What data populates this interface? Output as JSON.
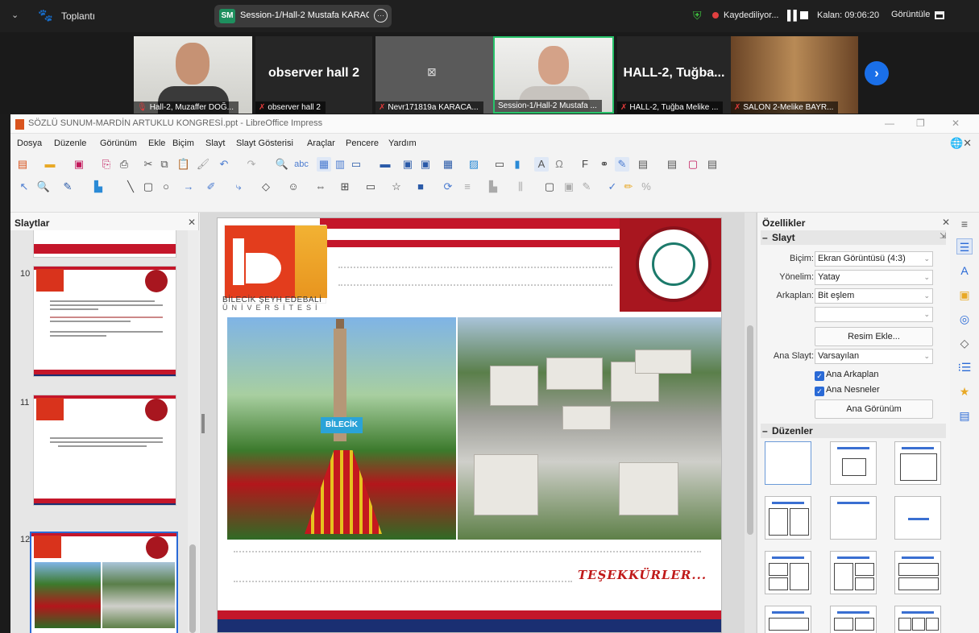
{
  "zoom": {
    "meeting_label": "Toplantı",
    "session_badge": "SM",
    "session_title": "Session-1/Hall-2 Mustafa KARAC",
    "recording": "Kaydediliyor...",
    "remaining": "Kalan: 09:06:20",
    "view_label": "Görüntüle",
    "participants": [
      {
        "name": "Hall-2, Muzaffer DOĞ...",
        "big": ""
      },
      {
        "name": "observer hall 2",
        "big": "observer hall 2"
      },
      {
        "name": "Nevr171819a KARACA...",
        "big": ""
      },
      {
        "name": "Session-1/Hall-2 Mustafa ...",
        "big": ""
      },
      {
        "name": "HALL-2, Tuğba Melike ...",
        "big": "HALL-2, Tuğba..."
      },
      {
        "name": "SALON 2-Melike BAYR...",
        "big": ""
      }
    ]
  },
  "lo": {
    "title": "SÖZLÜ SUNUM-MARDİN ARTUKLU KONGRESİ.ppt - LibreOffice Impress",
    "menus": [
      "Dosya",
      "Düzenle",
      "Görünüm",
      "Ekle",
      "Biçim",
      "Slayt",
      "Slayt Gösterisi",
      "Araçlar",
      "Pencere",
      "Yardım"
    ],
    "slides_panel": {
      "title": "Slaytlar",
      "slide_numbers": [
        "10",
        "11",
        "12"
      ]
    },
    "slide": {
      "uni_line1": "BİLECİK ŞEYH EDEBALİ",
      "uni_line2": "ÜNİVERSİTESİ",
      "sign_text": "BİLECİK",
      "thanks": "TEŞEKKÜRLER..."
    },
    "properties": {
      "title": "Özellikler",
      "section_slide": "Slayt",
      "format_label": "Biçim:",
      "format_value": "Ekran Görüntüsü (4:3)",
      "orientation_label": "Yönelim:",
      "orientation_value": "Yatay",
      "background_label": "Arkaplan:",
      "background_value": "Bit eşlem",
      "background_sub_value": "",
      "insert_image": "Resim Ekle...",
      "master_label": "Ana Slayt:",
      "master_value": "Varsayılan",
      "master_bg": "Ana Arkaplan",
      "master_objects": "Ana Nesneler",
      "master_view": "Ana Görünüm",
      "section_layouts": "Düzenler"
    }
  }
}
